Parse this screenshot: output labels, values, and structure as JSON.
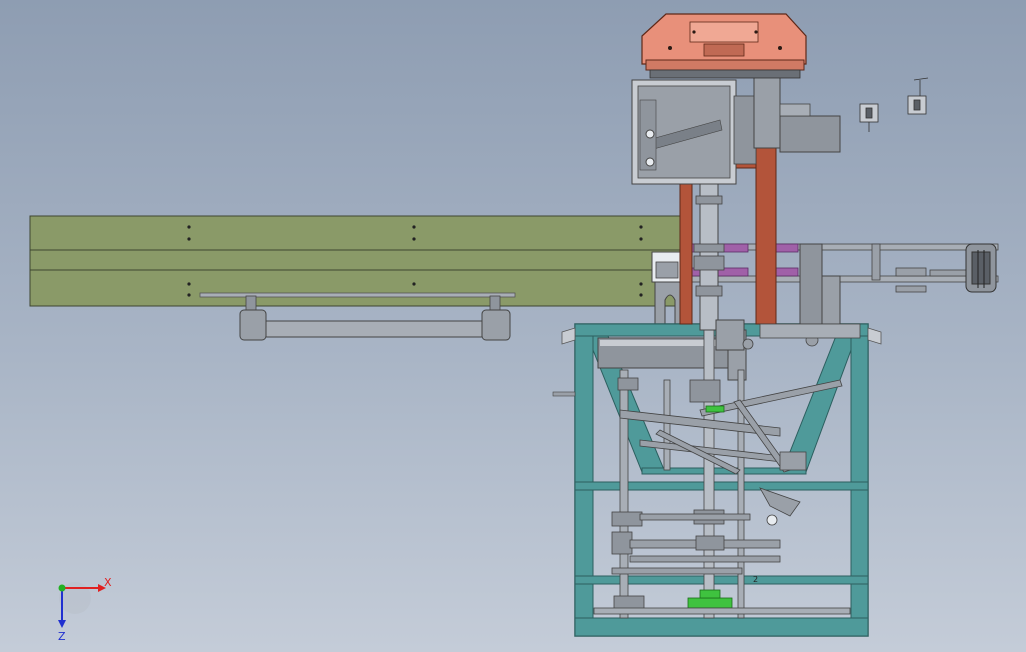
{
  "triad": {
    "x_label": "X",
    "z_label": "Z",
    "x_color": "#e02020",
    "y_color": "#22b022",
    "z_color": "#2030d0"
  },
  "callout": {
    "text": "2"
  },
  "colors": {
    "conveyor": "#8a9a68",
    "frame": "#4f9a9a",
    "steel": "#9aa0a8",
    "dark_steel": "#5a5f66",
    "post": "#b3543a",
    "head": "#e8907a",
    "purple": "#a060a8",
    "green_part": "#3fc23f"
  }
}
